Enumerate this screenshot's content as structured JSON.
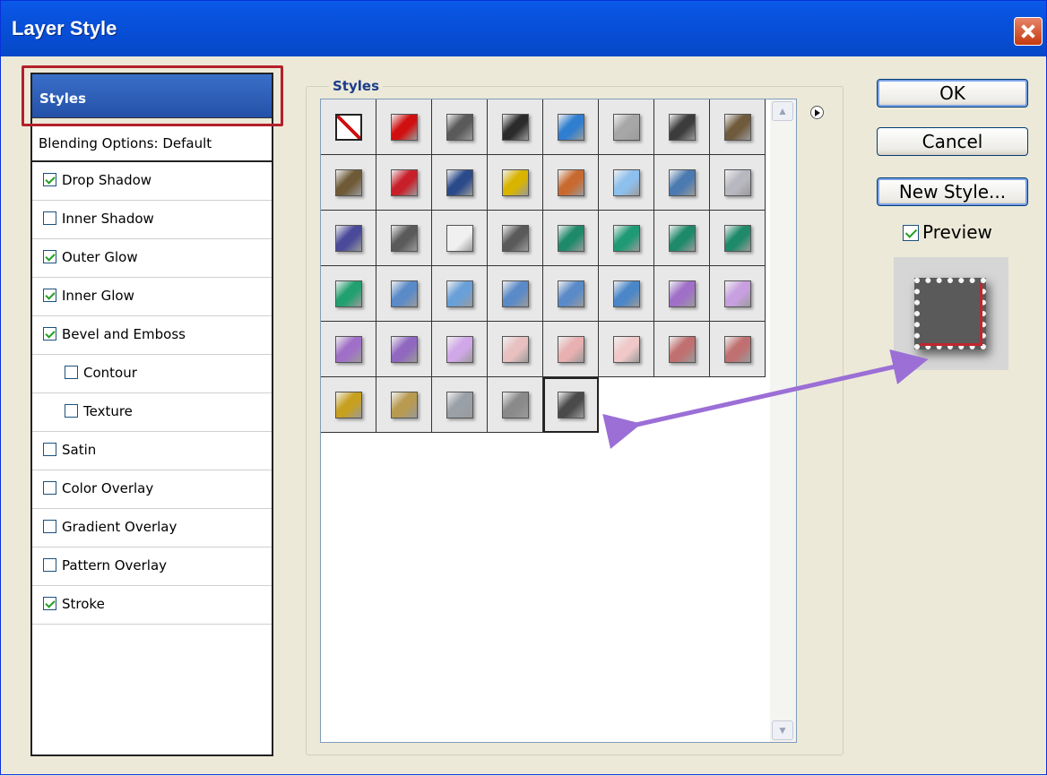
{
  "window": {
    "title": "Layer Style"
  },
  "left_panel": {
    "header": "Styles",
    "blending": "Blending Options: Default",
    "items": [
      {
        "label": "Drop Shadow",
        "checked": true,
        "indent": false
      },
      {
        "label": "Inner Shadow",
        "checked": false,
        "indent": false
      },
      {
        "label": "Outer Glow",
        "checked": true,
        "indent": false
      },
      {
        "label": "Inner Glow",
        "checked": true,
        "indent": false
      },
      {
        "label": "Bevel and Emboss",
        "checked": true,
        "indent": false
      },
      {
        "label": "Contour",
        "checked": false,
        "indent": true
      },
      {
        "label": "Texture",
        "checked": false,
        "indent": true
      },
      {
        "label": "Satin",
        "checked": false,
        "indent": false
      },
      {
        "label": "Color Overlay",
        "checked": false,
        "indent": false
      },
      {
        "label": "Gradient Overlay",
        "checked": false,
        "indent": false
      },
      {
        "label": "Pattern Overlay",
        "checked": false,
        "indent": false
      },
      {
        "label": "Stroke",
        "checked": true,
        "indent": false
      }
    ]
  },
  "styles_group": {
    "label": "Styles",
    "swatches": [
      [
        "none",
        "#d01010",
        "#5a5a5a",
        "#2b2b2b",
        "#2f7ed0",
        "#a7a7a7",
        "#3c3c3c",
        "#6f5a3c"
      ],
      [
        "#6e5a36",
        "#c8202a",
        "#2a4a8a",
        "#d8b400",
        "#c86a30",
        "#8ec0ee",
        "#4a7ab0",
        "#b8b8c0"
      ],
      [
        "#4a4a9a",
        "#5a5a5a",
        "#f0f0f0",
        "#5a5a5a",
        "#1f8a6a",
        "#1f9a74",
        "#1f8a6a",
        "#1f8a6a"
      ],
      [
        "#22a070",
        "#5a8ac8",
        "#6aa0d8",
        "#5a8ac8",
        "#5a8ac8",
        "#4a86c8",
        "#a070c8",
        "#c8a0e0"
      ],
      [
        "#a070c8",
        "#9068c0",
        "#d0a8e8",
        "#e8c0c0",
        "#e8b0b0",
        "#f0c8c8",
        "#c07070",
        "#c07070"
      ],
      [
        "#c8a020",
        "#b89a50",
        "#9aa0a8",
        "#8a8a8a",
        "#4a4a4a"
      ]
    ],
    "selected": [
      5,
      4
    ]
  },
  "buttons": {
    "ok": "OK",
    "cancel": "Cancel",
    "new_style": "New Style..."
  },
  "preview": {
    "label": "Preview",
    "checked": true
  },
  "colors": {
    "title_bar": "#0851dc",
    "highlight": "#2451a8",
    "annotation_box": "#b4202a",
    "annotation_arrow": "#9b6fd6"
  }
}
